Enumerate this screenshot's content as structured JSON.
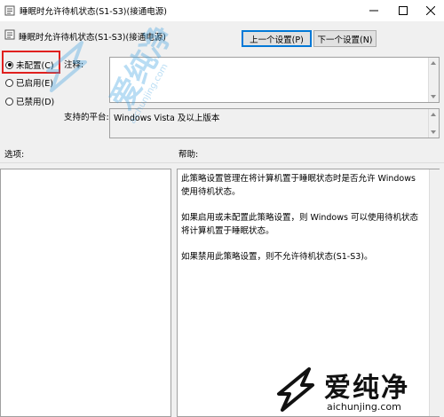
{
  "window": {
    "title": "睡眠时允许待机状态(S1-S3)(接通电源)",
    "minimize_icon": "minimize-icon",
    "maximize_icon": "maximize-icon",
    "close_icon": "close-icon"
  },
  "header": {
    "title": "睡眠时允许待机状态(S1-S3)(接通电源)",
    "prev_label": "上一个设置(P)",
    "next_label": "下一个设置(N)"
  },
  "state": {
    "options": [
      {
        "label": "未配置(C)",
        "selected": true
      },
      {
        "label": "已启用(E)",
        "selected": false
      },
      {
        "label": "已禁用(D)",
        "selected": false
      }
    ],
    "highlight_color": "#e0201e"
  },
  "comment": {
    "label": "注释:",
    "value": ""
  },
  "platform": {
    "label": "支持的平台:",
    "value": "Windows Vista 及以上版本"
  },
  "options_label": "选项:",
  "help": {
    "label": "帮助:",
    "paragraphs": [
      "此策略设置管理在将计算机置于睡眠状态时是否允许 Windows 使用待机状态。",
      "如果启用或未配置此策略设置，则 Windows 可以使用待机状态将计算机置于睡眠状态。",
      "如果禁用此策略设置，则不允许待机状态(S1-S3)。"
    ]
  },
  "watermark": {
    "brand": "爱纯净",
    "url": "aichunjing.com",
    "color": "#3aa0e0"
  }
}
